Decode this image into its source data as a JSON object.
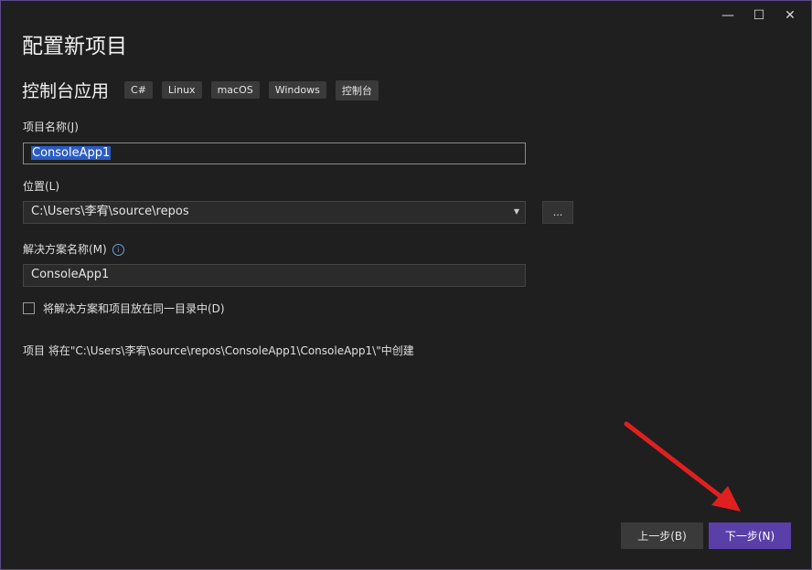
{
  "window_controls": {
    "minimize": "—",
    "maximize": "☐",
    "close": "✕"
  },
  "page_title": "配置新项目",
  "template": {
    "name": "控制台应用",
    "tags": [
      "C#",
      "Linux",
      "macOS",
      "Windows",
      "控制台"
    ]
  },
  "project_name": {
    "label": "项目名称(J)",
    "value": "ConsoleApp1"
  },
  "location": {
    "label": "位置(L)",
    "value": "C:\\Users\\李宥\\source\\repos",
    "browse_label": "..."
  },
  "solution_name": {
    "label": "解决方案名称(M)",
    "value": "ConsoleApp1",
    "info_icon": "i"
  },
  "same_directory": {
    "label": "将解决方案和项目放在同一目录中(D)",
    "checked": false
  },
  "summary": "项目 将在\"C:\\Users\\李宥\\source\\repos\\ConsoleApp1\\ConsoleApp1\\\"中创建",
  "buttons": {
    "back": "上一步(B)",
    "next": "下一步(N)"
  },
  "colors": {
    "accent": "#5a3fa8",
    "background": "#1f1f1f",
    "annotation_arrow": "#e02020"
  }
}
